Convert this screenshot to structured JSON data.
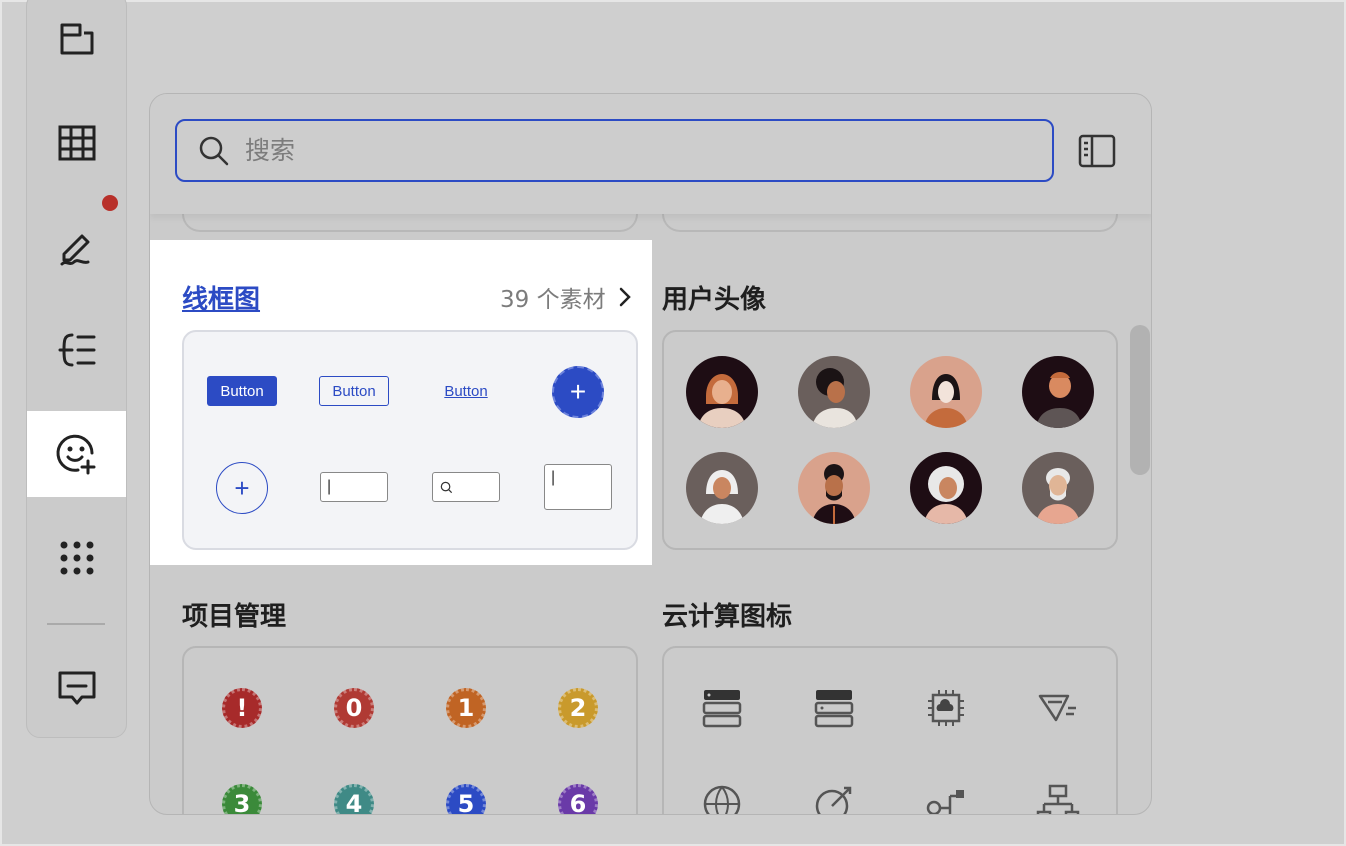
{
  "search": {
    "placeholder": "搜索"
  },
  "sections": {
    "wireframe": {
      "title": "线框图",
      "count": "39 个素材"
    },
    "avatars": {
      "title": "用户头像"
    },
    "project": {
      "title": "项目管理"
    },
    "cloud": {
      "title": "云计算图标"
    }
  },
  "wireframe_items": {
    "button_solid": "Button",
    "button_outline": "Button",
    "button_link": "Button",
    "fab_plus": "+",
    "circle_plus": "+",
    "field_cursor": "|",
    "textarea_cursor": "|"
  },
  "badges": [
    {
      "label": "!",
      "color": "#a72a2a"
    },
    {
      "label": "0",
      "color": "#b03a34"
    },
    {
      "label": "1",
      "color": "#c06424"
    },
    {
      "label": "2",
      "color": "#c99a2c"
    },
    {
      "label": "3",
      "color": "#3b8a3a"
    },
    {
      "label": "4",
      "color": "#3f8a86"
    },
    {
      "label": "5",
      "color": "#2c4bc4"
    },
    {
      "label": "6",
      "color": "#6a3aa8"
    }
  ],
  "colors": {
    "accent": "#2c4bc4",
    "notification": "#b8302a"
  }
}
